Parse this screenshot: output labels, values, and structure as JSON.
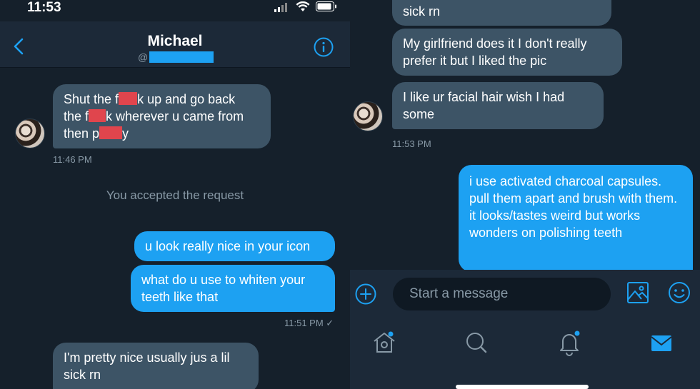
{
  "left": {
    "status": {
      "time": "11:53"
    },
    "header": {
      "name": "Michael",
      "handle_prefix": "@"
    },
    "messages": {
      "m1_line1": "Shut the f",
      "m1_line1b": "k up and go back",
      "m1_line2": "the f",
      "m1_line2b": "k wherever u came from",
      "m1_line3": "then p",
      "m1_line3b": "y",
      "m1_time": "11:46 PM",
      "system": "You accepted the request",
      "m2": "u look really nice in your icon",
      "m3": "what do u use to whiten your teeth like that",
      "m3_time": "11:51 PM ✓",
      "m4": "I'm pretty nice usually jus a lil sick rn"
    }
  },
  "right": {
    "messages": {
      "r1": "sick rn",
      "r2": "My girlfriend does it I don't really prefer it but I liked the pic",
      "r3": "I like ur facial hair wish I had some",
      "r3_time": "11:53 PM",
      "r4": "i use activated charcoal capsules. pull them apart and brush with them. it looks/tastes weird but works wonders on polishing teeth"
    },
    "composer": {
      "placeholder": "Start a message"
    }
  },
  "colors": {
    "accent": "#1da1f2",
    "background": "#15202b",
    "received_bubble": "#3d5466",
    "redaction": "#e0454d"
  },
  "icons": [
    "back-chevron",
    "info",
    "add",
    "image",
    "emoji",
    "home",
    "search",
    "notifications",
    "messages"
  ]
}
